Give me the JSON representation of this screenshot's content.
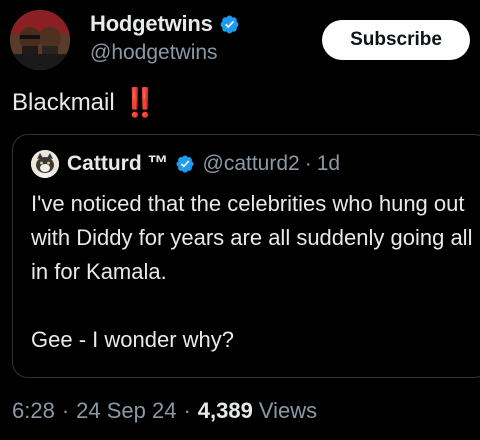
{
  "author": {
    "display_name": "Hodgetwins",
    "handle": "@hodgetwins",
    "verified": true,
    "avatar_icon": "twins-avatar"
  },
  "subscribe_label": "Subscribe",
  "tweet": {
    "text": "Blackmail",
    "emoji": "‼️"
  },
  "quote": {
    "display_name": "Catturd ™",
    "handle": "@catturd2",
    "dot": "·",
    "time": "1d",
    "verified": true,
    "avatar_icon": "cat-avatar",
    "body_line1": "I've noticed that the celebrities who hung out with Diddy for years are all suddenly going all in for Kamala.",
    "body_line2": "Gee - I wonder why?"
  },
  "meta": {
    "time": "6:28",
    "date": "24 Sep 24",
    "views_count": "4,389",
    "views_label": "Views",
    "separator": "·"
  },
  "colors": {
    "background": "#000000",
    "text": "#e7e9ea",
    "secondary": "#8b98a5",
    "verified": "#1d9bf0",
    "alert": "#f4212e",
    "border": "#2f3336"
  }
}
